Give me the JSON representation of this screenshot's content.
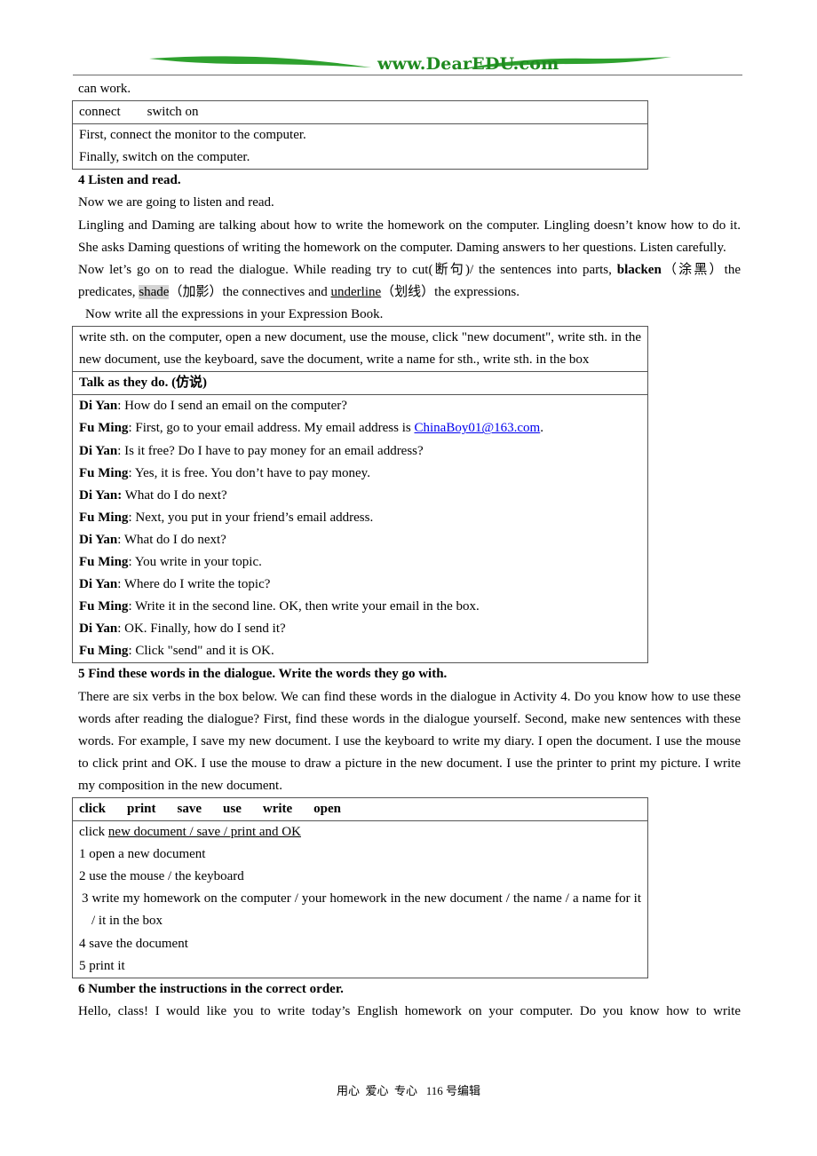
{
  "header": {
    "site_logo": "www.DearEDU.com"
  },
  "intro_tail": "can work.",
  "box1": {
    "words": "connect        switch on",
    "lines": [
      "First, connect the monitor to the computer.",
      "Finally, switch on the computer."
    ]
  },
  "activity4": {
    "title": "4 Listen and read.",
    "p1": "Now we are going to listen and read.",
    "p2": "Lingling and Daming are talking about how to write the homework on the computer. Lingling doesn’t know how to do it. She asks Daming questions of writing the homework on the computer. Daming answers to her questions. Listen carefully.",
    "p3_a": "Now let’s go on to read the dialogue. While reading try to cut(断句)/ the sentences into parts, ",
    "p3_bold": "blacken",
    "p3_b": "（涂黑）the predicates, ",
    "p3_shade": "shade",
    "p3_c": "（加影）the connectives and ",
    "p3_underline": "underline",
    "p3_d": "（划线）the expressions.",
    "p4": "Now write all the expressions in your Expression Book."
  },
  "box2": {
    "expressions": "write sth. on the computer, open a new document, use the mouse, click \"new document\", write sth. in the new document, use the keyboard, save the document, write a name for sth., write sth. in the box",
    "talk_title": "Talk as they do. (仿说)",
    "dialogue": [
      {
        "speaker": "Di Yan",
        "sep": ": ",
        "text": "How do I send an email on the computer?"
      },
      {
        "speaker": "Fu Ming",
        "sep": ": ",
        "text": "First, go to your email address. My email address is ",
        "link": "ChinaBoy01@163.com",
        "after": "."
      },
      {
        "speaker": "Di Yan",
        "sep": ": ",
        "text": "Is it free? Do I have to pay money for an email address?"
      },
      {
        "speaker": "Fu Ming",
        "sep": ": ",
        "text": "Yes, it is free. You don’t have to pay money."
      },
      {
        "speaker": "Di Yan:",
        "sep": " ",
        "text": "What do I do next?"
      },
      {
        "speaker": "Fu Ming",
        "sep": ": ",
        "text": "Next, you put in your friend’s email address."
      },
      {
        "speaker": "Di Yan",
        "sep": ": ",
        "text": "What do I do next?"
      },
      {
        "speaker": "Fu Ming",
        "sep": ": ",
        "text": "You write in your topic."
      },
      {
        "speaker": "Di Yan",
        "sep": ": ",
        "text": "Where do I write the topic?"
      },
      {
        "speaker": "Fu Ming",
        "sep": ": ",
        "text": "Write it in the second line. OK, then write your email in the box."
      },
      {
        "speaker": "Di Yan",
        "sep": ": ",
        "text": "OK. Finally, how do I send it?"
      },
      {
        "speaker": "Fu Ming",
        "sep": ": ",
        "text": "Click \"send\" and it is OK."
      }
    ]
  },
  "activity5": {
    "title": "5 Find these words in the dialogue. Write the words they go with.",
    "p1": "There are six verbs in the box below. We can find these words in the dialogue in Activity 4. Do you know how to use these words after reading the dialogue? First, find these words in the dialogue yourself. Second, make new sentences with these words. For example, I save my new document. I use the keyboard to write my diary. I open the document. I use the mouse to click print and OK. I use the mouse to draw a picture in the new document. I use the printer to print my picture. I write my composition in the new document."
  },
  "box3": {
    "words": [
      "click",
      "print",
      "save",
      "use",
      "write",
      "open"
    ],
    "example_verb": "click ",
    "example_rest": "new document / save / print and OK",
    "items": [
      "1 open a new document",
      "2 use the mouse / the keyboard",
      "3 write my homework on the computer / your homework in the new document / the name / a name for it / it in the box",
      "4 save the document",
      "5 print it"
    ]
  },
  "activity6": {
    "title": "6 Number the instructions in the correct order.",
    "p1": "Hello, class! I would like you to write today’s English homework on your computer. Do you know how to write"
  },
  "footer": {
    "text": "用心  爱心  专心   116 号编辑"
  }
}
